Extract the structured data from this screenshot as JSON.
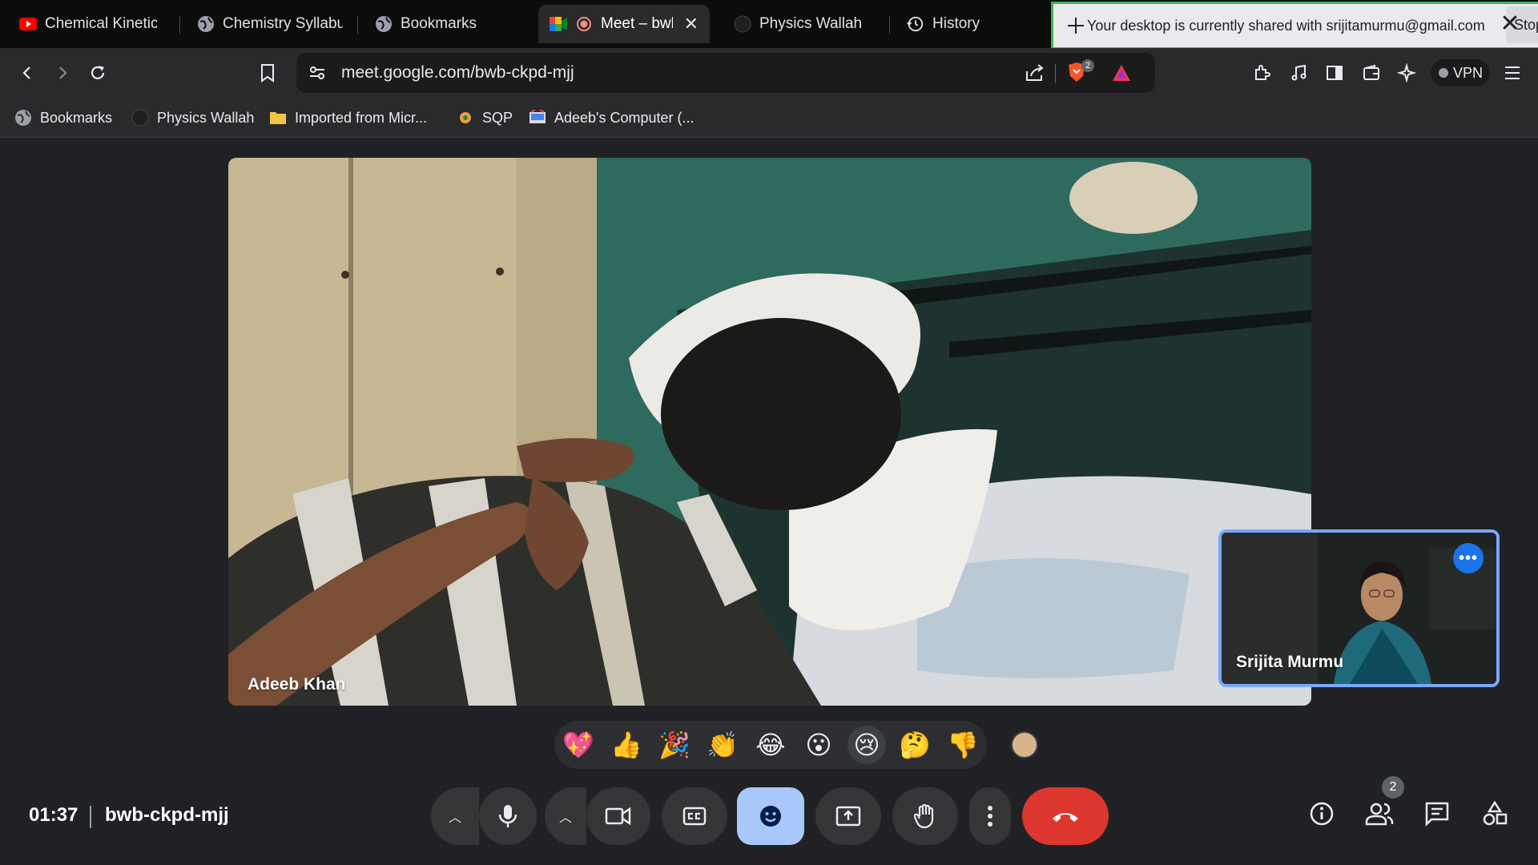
{
  "browser": {
    "tabs": [
      {
        "label": "Chemical Kinetics",
        "icon": "youtube-icon"
      },
      {
        "label": "Chemistry Syllabus",
        "icon": "globe-icon"
      },
      {
        "label": "Bookmarks",
        "icon": "globe-icon"
      },
      {
        "label": "Meet – bwb",
        "icon": "meet-icon",
        "active": true
      },
      {
        "label": "Physics Wallah",
        "icon": "pw-icon"
      },
      {
        "label": "History",
        "icon": "history-icon"
      }
    ],
    "share_banner": {
      "text": "Your desktop is currently shared with srijitamurmu@gmail.com",
      "stop_label": "Stop"
    },
    "url": "meet.google.com/bwb-ckpd-mjj",
    "brave_badge": "2",
    "vpn_label": "VPN",
    "bookmarks": [
      {
        "label": "Bookmarks",
        "icon": "globe-icon"
      },
      {
        "label": "Physics Wallah",
        "icon": "pw-icon"
      },
      {
        "label": "Imported from Micr...",
        "icon": "folder-icon"
      },
      {
        "label": "SQP",
        "icon": "sqp-icon"
      },
      {
        "label": "Adeeb's Computer (...",
        "icon": "remote-desktop-icon"
      }
    ]
  },
  "meet": {
    "main_participant": "Adeeb Khan",
    "self_participant": "Srijita Murmu",
    "reactions": [
      "💖",
      "👍",
      "🎉",
      "👏",
      "😂",
      "😮",
      "😢",
      "🤔",
      "👎"
    ],
    "selected_reaction": "😢",
    "time": "01:37",
    "meeting_code": "bwb-ckpd-mjj",
    "participant_count": "2",
    "colors": {
      "accent": "#a8c7fa",
      "hangup": "#dc362e",
      "self_border": "#7aa7ff"
    }
  }
}
